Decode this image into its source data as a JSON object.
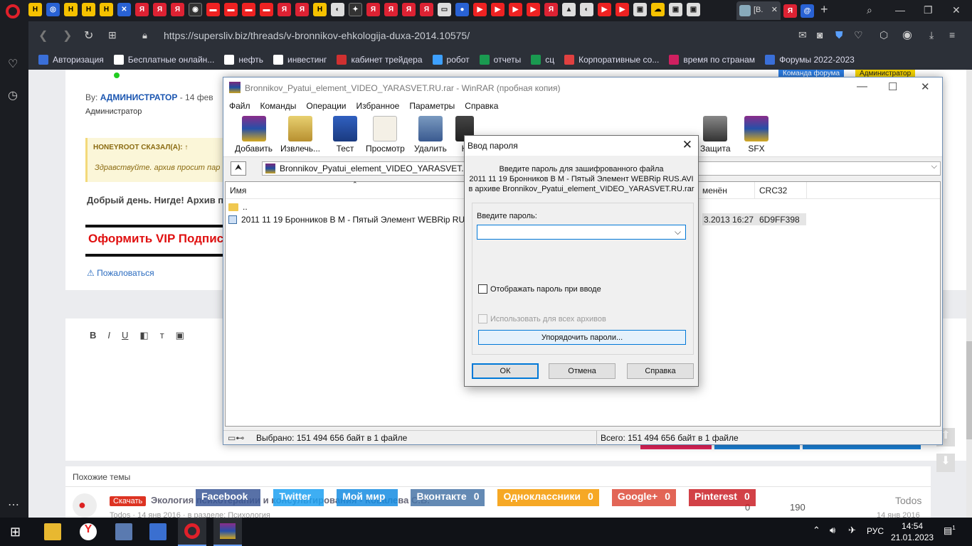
{
  "browser": {
    "active_tab_label": "[В.",
    "url": "https://supersliv.biz/threads/v-bronnikov-ehkologija-duxa-2014.10575/",
    "bookmarks": [
      {
        "label": "Авторизация",
        "color": "#3a6fd8"
      },
      {
        "label": "Бесплатные онлайн...",
        "color": "#ffffff"
      },
      {
        "label": "нефть",
        "color": "#ffffff"
      },
      {
        "label": "инвестинг",
        "color": "#ffffff"
      },
      {
        "label": "кабинет трейдера",
        "color": "#d03030"
      },
      {
        "label": "робот",
        "color": "#3da0ff"
      },
      {
        "label": "отчеты",
        "color": "#1a9a50"
      },
      {
        "label": "сц",
        "color": "#1a9a50"
      },
      {
        "label": "Корпоративные со...",
        "color": "#e04040"
      },
      {
        "label": "время по странам",
        "color": "#d02060"
      },
      {
        "label": "Форумы 2022-2023",
        "color": "#3a6fd8"
      }
    ]
  },
  "page": {
    "author_prefix": "By:",
    "author": "АДМИНИСТРАТОР",
    "author_date": "14 фев",
    "author_role": "Администратор",
    "badge_team": "Команда форума",
    "badge_admin": "Администратор",
    "quote_author": "HONEYROOT СКАЗАЛ(А): ↑",
    "quote_text": "Здравствуйте. архив просит пар",
    "reply_text": "Добрый день. Нигде! Архив п",
    "vip_text": "Оформить VIP Подпис",
    "report": "Пожаловаться",
    "editor_tools": [
      "B",
      "I",
      "U"
    ],
    "similar_title": "Похожие темы",
    "similar_download": "Скачать",
    "similar_topic": "Экология психотерапии и консультирования - Ковалева С.В.",
    "similar_meta": "Todos · 14 янв 2016 · в разделе: Психология",
    "similar_user": "Todos",
    "similar_replies": "0",
    "similar_views": "190",
    "similar_date": "14 янв 2016",
    "share": [
      {
        "label": "Facebook",
        "count": "",
        "color": "#3b5998"
      },
      {
        "label": "Twitter",
        "count": "",
        "color": "#1da1f2"
      },
      {
        "label": "Мой мир",
        "count": "",
        "color": "#168de2"
      },
      {
        "label": "Вконтакте",
        "count": "0",
        "color": "#4a76a8"
      },
      {
        "label": "Одноклассники",
        "count": "0",
        "color": "#f59a00"
      },
      {
        "label": "Google+",
        "count": "0",
        "color": "#dd4b39"
      },
      {
        "label": "Pinterest",
        "count": "0",
        "color": "#cb2027"
      }
    ]
  },
  "winrar": {
    "title": "Bronnikov_Pyatui_element_VIDEO_YARASVET.RU.rar - WinRAR (пробная копия)",
    "menu": [
      "Файл",
      "Команды",
      "Операции",
      "Избранное",
      "Параметры",
      "Справка"
    ],
    "toolbar": [
      "Добавить",
      "Извлечь...",
      "Тест",
      "Просмотр",
      "Удалить",
      "Н",
      "",
      "",
      "",
      "Защита",
      "SFX"
    ],
    "path": "Bronnikov_Pyatui_element_VIDEO_YARASVET.RU.rar",
    "columns": {
      "name": "Имя",
      "modified": "менён",
      "crc": "CRC32"
    },
    "rows": [
      {
        "name": "..",
        "modified": "",
        "crc": ""
      },
      {
        "name": "2011 11 19 Бронников В М - Пятый Элемент WEBRip RUS.A",
        "modified": "3.2013 16:27",
        "crc": "6D9FF398"
      }
    ],
    "status_left": "Выбрано: 151 494 656 байт в 1 файле",
    "status_right": "Всего: 151 494 656 байт в 1 файле"
  },
  "dialog": {
    "title": "Ввод пароля",
    "info_line1": "Введите пароль для зашифрованного файла",
    "info_line2": "2011 11 19 Бронников В М - Пятый Элемент WEBRip RUS.AVI",
    "info_line3": "в архиве Bronnikov_Pyatui_element_VIDEO_YARASVET.RU.rar",
    "password_label": "Введите пароль:",
    "password_value": "",
    "show_password": "Отображать пароль при вводе",
    "use_for_all": "Использовать для всех архивов",
    "organize": "Упорядочить пароли...",
    "ok": "ОК",
    "cancel": "Отмена",
    "help": "Справка"
  },
  "taskbar": {
    "lang": "РУС",
    "time": "14:54",
    "date": "21.01.2023",
    "notifications": "1"
  }
}
